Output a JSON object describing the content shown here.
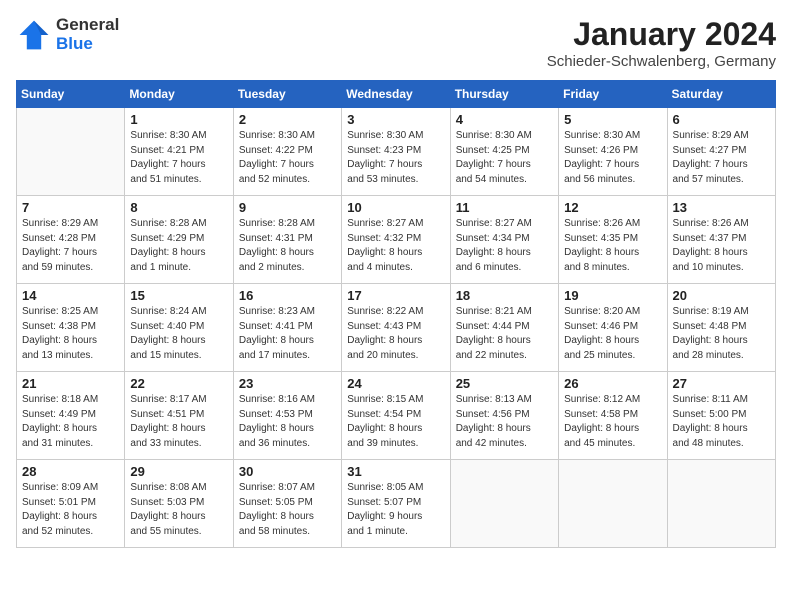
{
  "header": {
    "logo_general": "General",
    "logo_blue": "Blue",
    "month_year": "January 2024",
    "location": "Schieder-Schwalenberg, Germany"
  },
  "days_of_week": [
    "Sunday",
    "Monday",
    "Tuesday",
    "Wednesday",
    "Thursday",
    "Friday",
    "Saturday"
  ],
  "weeks": [
    [
      {
        "day": "",
        "info": ""
      },
      {
        "day": "1",
        "info": "Sunrise: 8:30 AM\nSunset: 4:21 PM\nDaylight: 7 hours\nand 51 minutes."
      },
      {
        "day": "2",
        "info": "Sunrise: 8:30 AM\nSunset: 4:22 PM\nDaylight: 7 hours\nand 52 minutes."
      },
      {
        "day": "3",
        "info": "Sunrise: 8:30 AM\nSunset: 4:23 PM\nDaylight: 7 hours\nand 53 minutes."
      },
      {
        "day": "4",
        "info": "Sunrise: 8:30 AM\nSunset: 4:25 PM\nDaylight: 7 hours\nand 54 minutes."
      },
      {
        "day": "5",
        "info": "Sunrise: 8:30 AM\nSunset: 4:26 PM\nDaylight: 7 hours\nand 56 minutes."
      },
      {
        "day": "6",
        "info": "Sunrise: 8:29 AM\nSunset: 4:27 PM\nDaylight: 7 hours\nand 57 minutes."
      }
    ],
    [
      {
        "day": "7",
        "info": "Sunrise: 8:29 AM\nSunset: 4:28 PM\nDaylight: 7 hours\nand 59 minutes."
      },
      {
        "day": "8",
        "info": "Sunrise: 8:28 AM\nSunset: 4:29 PM\nDaylight: 8 hours\nand 1 minute."
      },
      {
        "day": "9",
        "info": "Sunrise: 8:28 AM\nSunset: 4:31 PM\nDaylight: 8 hours\nand 2 minutes."
      },
      {
        "day": "10",
        "info": "Sunrise: 8:27 AM\nSunset: 4:32 PM\nDaylight: 8 hours\nand 4 minutes."
      },
      {
        "day": "11",
        "info": "Sunrise: 8:27 AM\nSunset: 4:34 PM\nDaylight: 8 hours\nand 6 minutes."
      },
      {
        "day": "12",
        "info": "Sunrise: 8:26 AM\nSunset: 4:35 PM\nDaylight: 8 hours\nand 8 minutes."
      },
      {
        "day": "13",
        "info": "Sunrise: 8:26 AM\nSunset: 4:37 PM\nDaylight: 8 hours\nand 10 minutes."
      }
    ],
    [
      {
        "day": "14",
        "info": "Sunrise: 8:25 AM\nSunset: 4:38 PM\nDaylight: 8 hours\nand 13 minutes."
      },
      {
        "day": "15",
        "info": "Sunrise: 8:24 AM\nSunset: 4:40 PM\nDaylight: 8 hours\nand 15 minutes."
      },
      {
        "day": "16",
        "info": "Sunrise: 8:23 AM\nSunset: 4:41 PM\nDaylight: 8 hours\nand 17 minutes."
      },
      {
        "day": "17",
        "info": "Sunrise: 8:22 AM\nSunset: 4:43 PM\nDaylight: 8 hours\nand 20 minutes."
      },
      {
        "day": "18",
        "info": "Sunrise: 8:21 AM\nSunset: 4:44 PM\nDaylight: 8 hours\nand 22 minutes."
      },
      {
        "day": "19",
        "info": "Sunrise: 8:20 AM\nSunset: 4:46 PM\nDaylight: 8 hours\nand 25 minutes."
      },
      {
        "day": "20",
        "info": "Sunrise: 8:19 AM\nSunset: 4:48 PM\nDaylight: 8 hours\nand 28 minutes."
      }
    ],
    [
      {
        "day": "21",
        "info": "Sunrise: 8:18 AM\nSunset: 4:49 PM\nDaylight: 8 hours\nand 31 minutes."
      },
      {
        "day": "22",
        "info": "Sunrise: 8:17 AM\nSunset: 4:51 PM\nDaylight: 8 hours\nand 33 minutes."
      },
      {
        "day": "23",
        "info": "Sunrise: 8:16 AM\nSunset: 4:53 PM\nDaylight: 8 hours\nand 36 minutes."
      },
      {
        "day": "24",
        "info": "Sunrise: 8:15 AM\nSunset: 4:54 PM\nDaylight: 8 hours\nand 39 minutes."
      },
      {
        "day": "25",
        "info": "Sunrise: 8:13 AM\nSunset: 4:56 PM\nDaylight: 8 hours\nand 42 minutes."
      },
      {
        "day": "26",
        "info": "Sunrise: 8:12 AM\nSunset: 4:58 PM\nDaylight: 8 hours\nand 45 minutes."
      },
      {
        "day": "27",
        "info": "Sunrise: 8:11 AM\nSunset: 5:00 PM\nDaylight: 8 hours\nand 48 minutes."
      }
    ],
    [
      {
        "day": "28",
        "info": "Sunrise: 8:09 AM\nSunset: 5:01 PM\nDaylight: 8 hours\nand 52 minutes."
      },
      {
        "day": "29",
        "info": "Sunrise: 8:08 AM\nSunset: 5:03 PM\nDaylight: 8 hours\nand 55 minutes."
      },
      {
        "day": "30",
        "info": "Sunrise: 8:07 AM\nSunset: 5:05 PM\nDaylight: 8 hours\nand 58 minutes."
      },
      {
        "day": "31",
        "info": "Sunrise: 8:05 AM\nSunset: 5:07 PM\nDaylight: 9 hours\nand 1 minute."
      },
      {
        "day": "",
        "info": ""
      },
      {
        "day": "",
        "info": ""
      },
      {
        "day": "",
        "info": ""
      }
    ]
  ]
}
